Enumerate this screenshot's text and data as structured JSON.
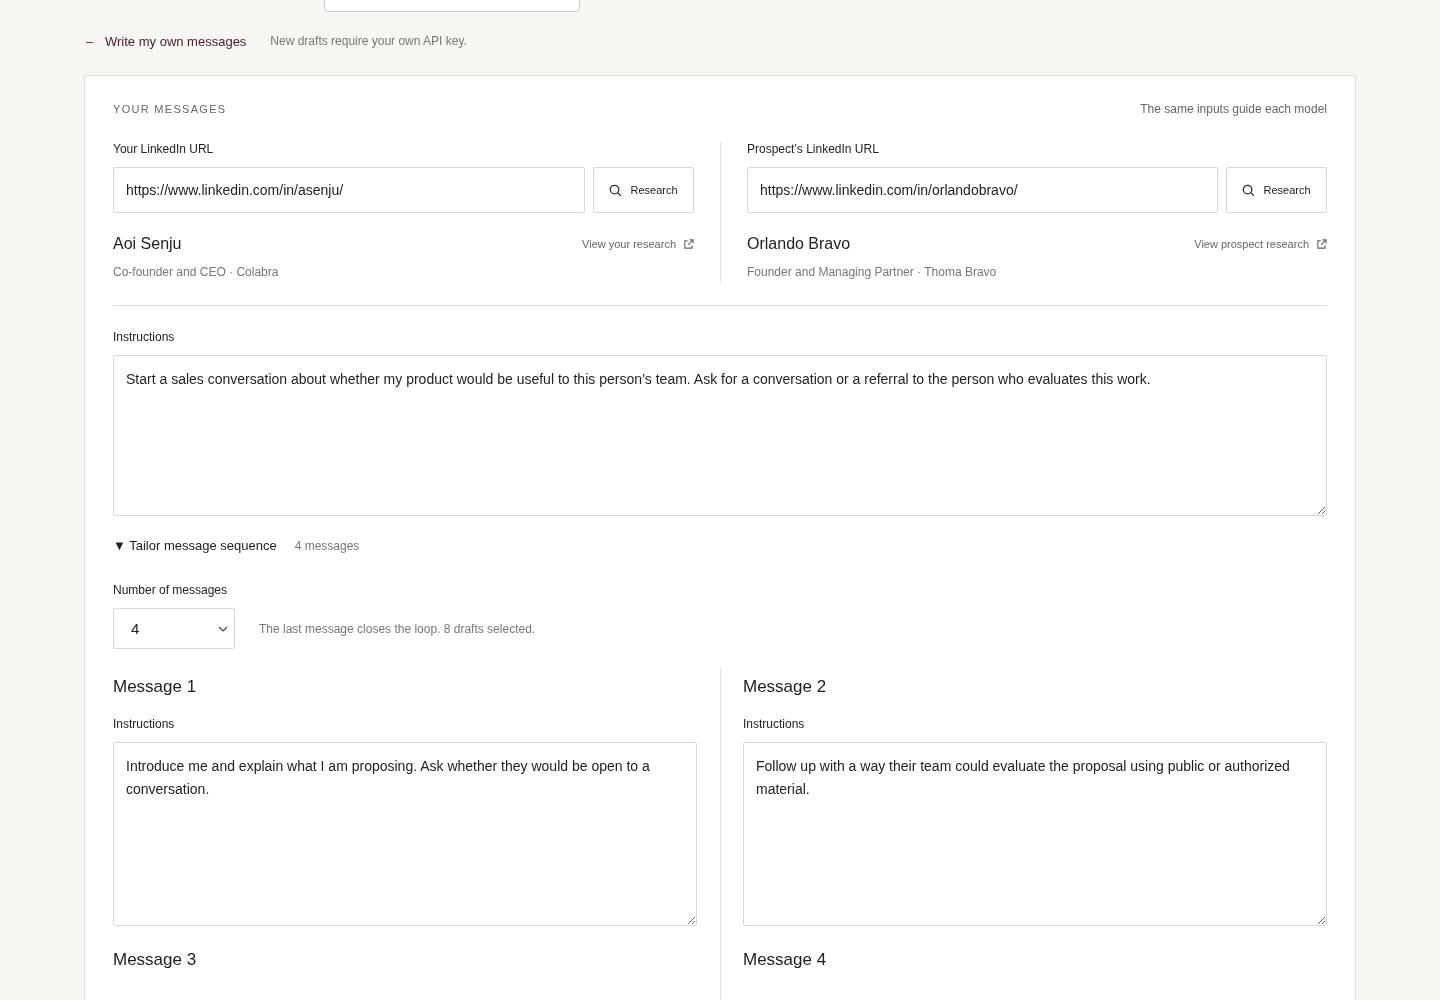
{
  "own_messages": {
    "toggle": "–",
    "label": "Write my own messages",
    "note": "New drafts require your own API key."
  },
  "panel": {
    "heading": "YOUR MESSAGES",
    "subtitle": "The same inputs guide each model",
    "profiles": [
      {
        "label": "Your LinkedIn URL",
        "value": "https://www.linkedin.com/in/asenju/",
        "button": "Research",
        "name": "Aoi Senju",
        "link": "View your research",
        "role": "Co-founder and CEO · Colabra"
      },
      {
        "label": "Prospect’s LinkedIn URL",
        "value": "https://www.linkedin.com/in/orlandobravo/",
        "button": "Research",
        "name": "Orlando Bravo",
        "link": "View prospect research",
        "role": "Founder and Managing Partner · Thoma Bravo"
      }
    ],
    "instructions": {
      "label": "Instructions",
      "value": "Start a sales conversation about whether my product would be useful to this person’s team. Ask for a conversation or a referral to the person who evaluates this work."
    },
    "sequence": {
      "toggle": "▼",
      "label": "Tailor message sequence",
      "count": "4 messages",
      "expanded": true,
      "number_label": "Number of messages",
      "number_value": "4",
      "hint": "The last message closes the loop. 8 drafts selected."
    },
    "messages": [
      {
        "title": "Message 1",
        "label": "Instructions",
        "value": "Introduce me and explain what I am proposing. Ask whether they would be open to a conversation."
      },
      {
        "title": "Message 2",
        "label": "Instructions",
        "value": "Follow up with a way their team could evaluate the proposal using public or authorized material."
      },
      {
        "title": "Message 3"
      },
      {
        "title": "Message 4"
      }
    ]
  }
}
